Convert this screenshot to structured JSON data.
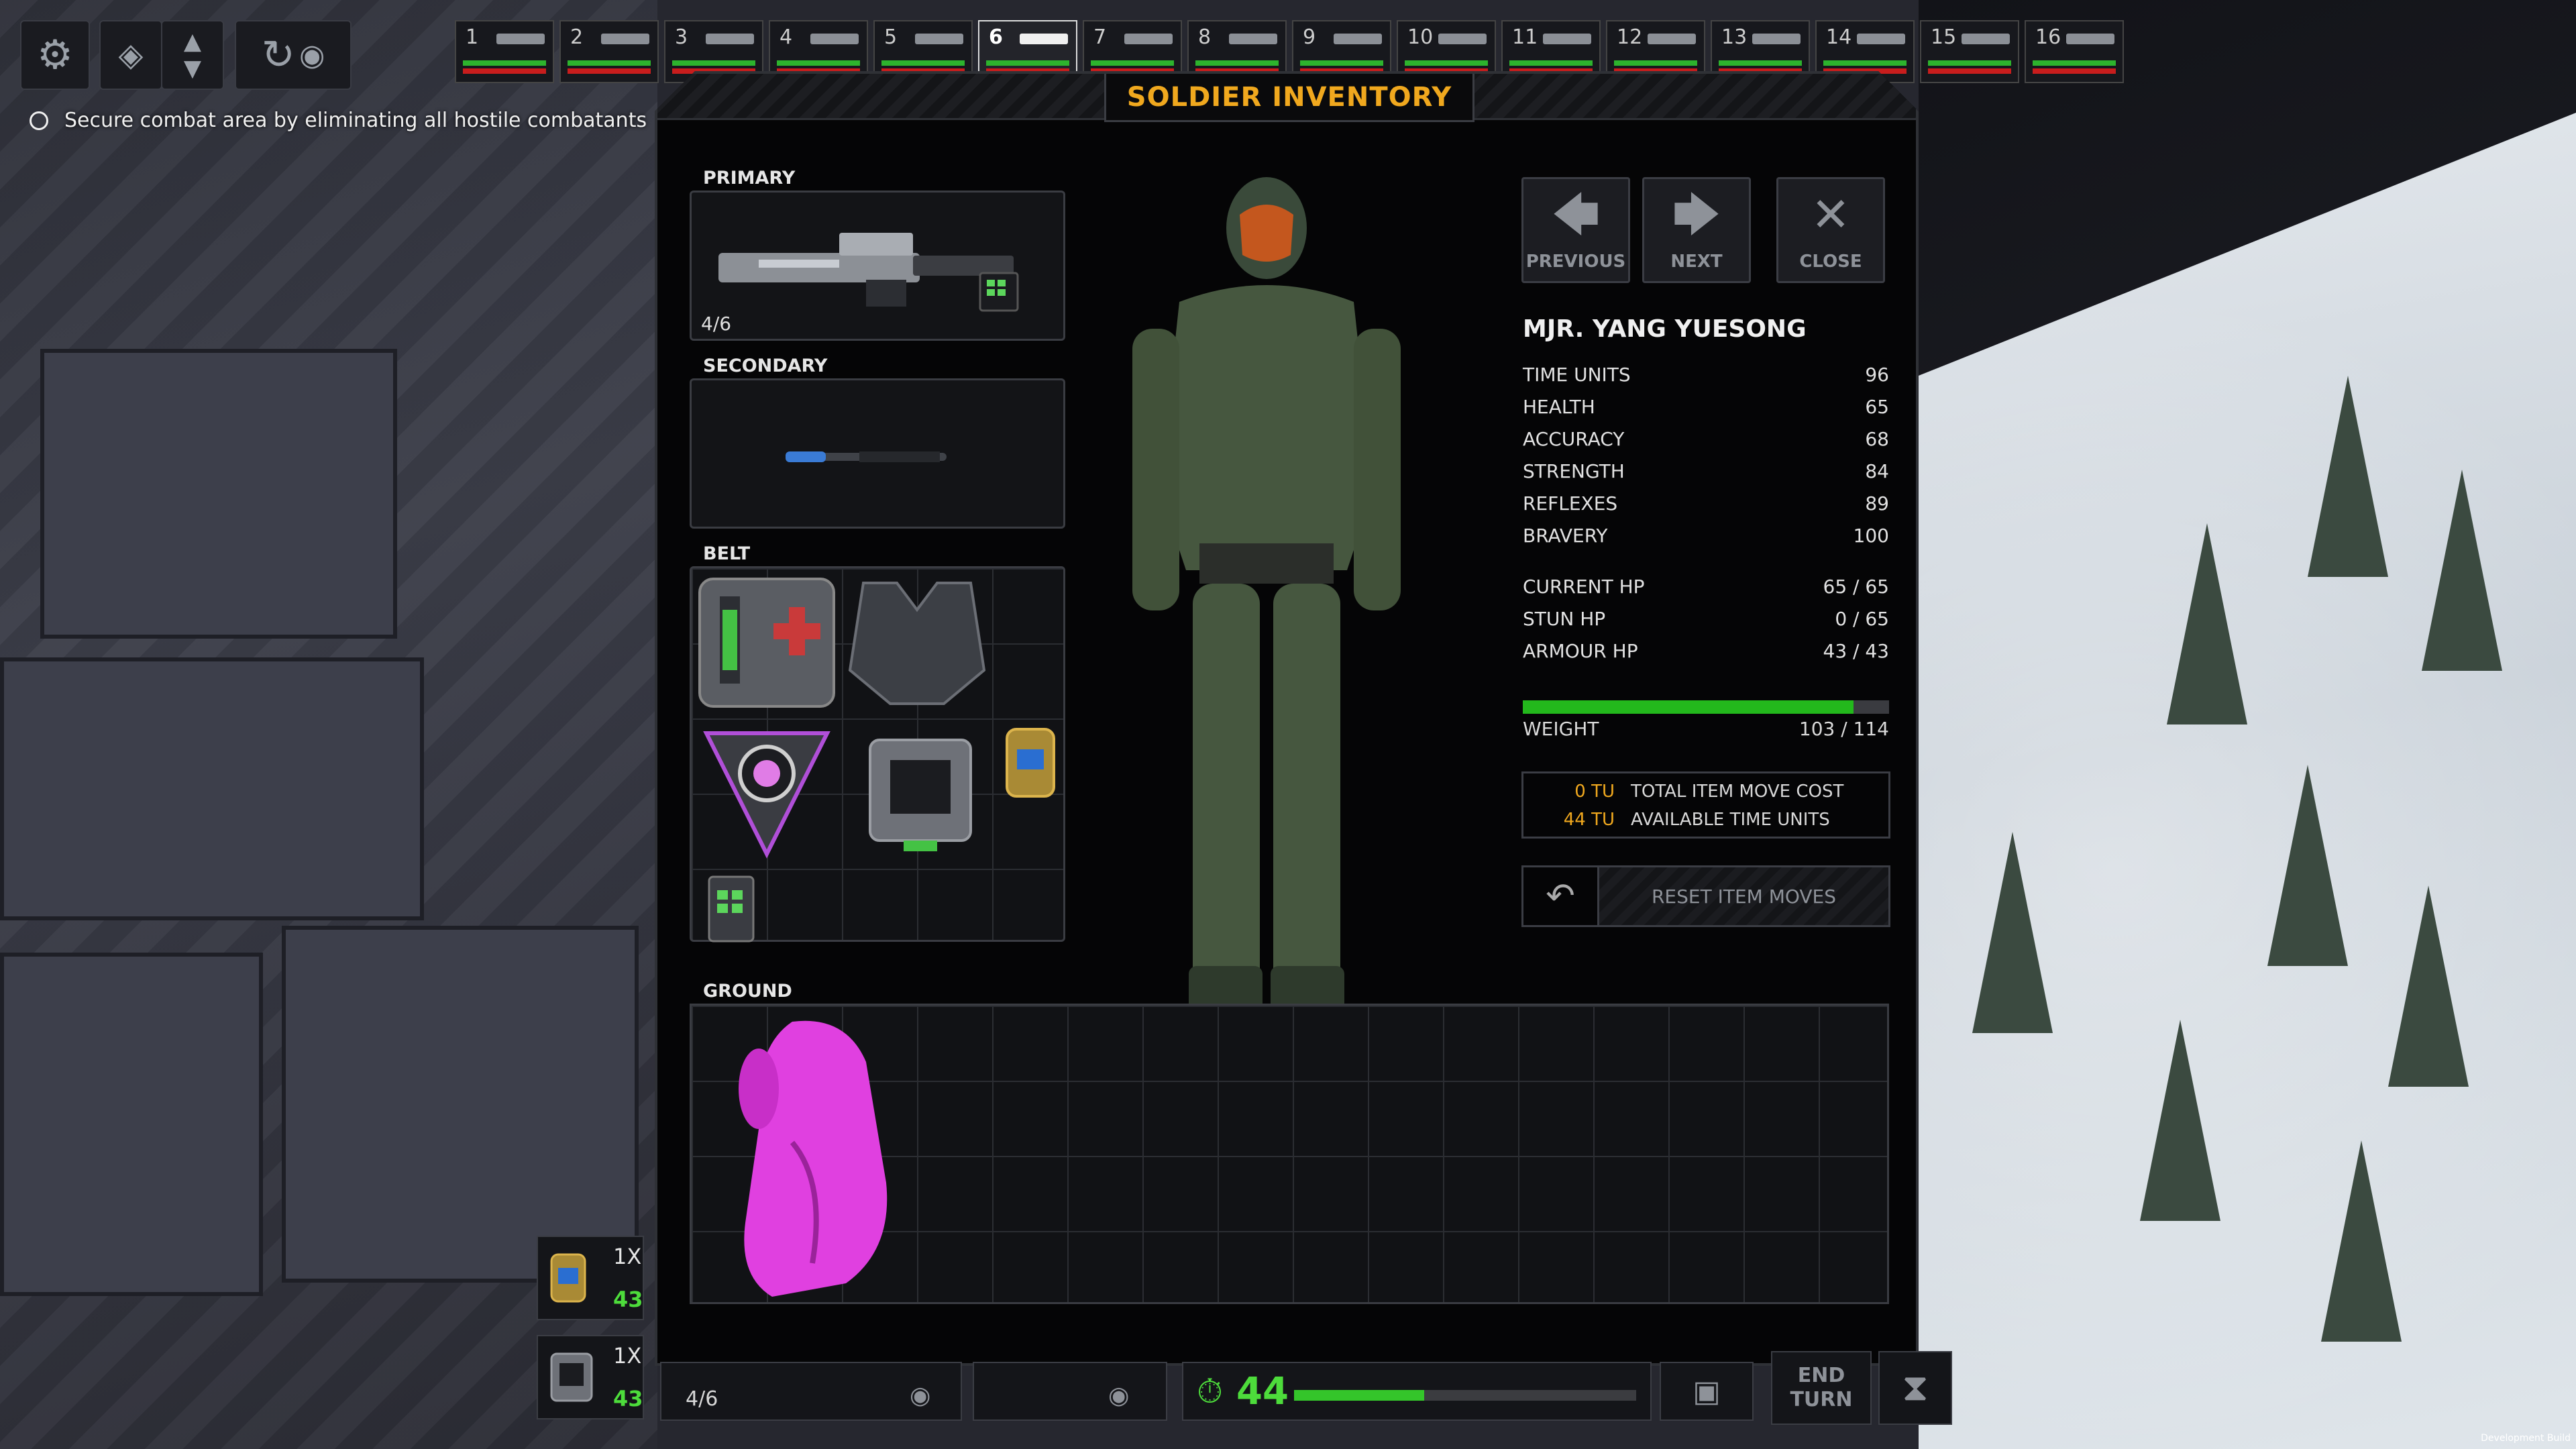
{
  "objective": {
    "text": "Secure combat area by eliminating all hostile combatants"
  },
  "squad": {
    "slots": [
      {
        "num": "1"
      },
      {
        "num": "2"
      },
      {
        "num": "3"
      },
      {
        "num": "4"
      },
      {
        "num": "5"
      },
      {
        "num": "6",
        "active": true
      },
      {
        "num": "7"
      },
      {
        "num": "8"
      },
      {
        "num": "9"
      },
      {
        "num": "10"
      },
      {
        "num": "11"
      },
      {
        "num": "12"
      },
      {
        "num": "13"
      },
      {
        "num": "14"
      },
      {
        "num": "15"
      },
      {
        "num": "16"
      }
    ]
  },
  "inventory": {
    "title": "SOLDIER INVENTORY",
    "primary_label": "PRIMARY",
    "primary_ammo": "4/6",
    "secondary_label": "SECONDARY",
    "belt_label": "BELT",
    "ground_label": "GROUND"
  },
  "nav": {
    "previous": "PREVIOUS",
    "next": "NEXT",
    "close": "CLOSE"
  },
  "soldier": {
    "name": "MJR. YANG YUESONG",
    "stats": [
      {
        "label": "TIME UNITS",
        "value": "96"
      },
      {
        "label": "HEALTH",
        "value": "65"
      },
      {
        "label": "ACCURACY",
        "value": "68"
      },
      {
        "label": "STRENGTH",
        "value": "84"
      },
      {
        "label": "REFLEXES",
        "value": "89"
      },
      {
        "label": "BRAVERY",
        "value": "100"
      }
    ],
    "hp": [
      {
        "label": "CURRENT HP",
        "value": "65 / 65"
      },
      {
        "label": "STUN HP",
        "value": "0 / 65"
      },
      {
        "label": "ARMOUR HP",
        "value": "43 / 43"
      }
    ],
    "weight_label": "WEIGHT",
    "weight_value": "103 / 114",
    "weight_fraction": 0.9035
  },
  "tu": {
    "cost_value": "0 TU",
    "cost_label": "TOTAL ITEM MOVE COST",
    "avail_value": "44 TU",
    "avail_label": "AVAILABLE TIME UNITS"
  },
  "reset": {
    "label": "RESET ITEM MOVES"
  },
  "hud": {
    "item1_qty": "1X",
    "item1_count": "43",
    "item2_qty": "1X",
    "item2_count": "43",
    "weapon_ammo": "4/6",
    "time_units": "44",
    "time_units_fraction": 0.38,
    "end_turn": "END TURN"
  },
  "footer": {
    "build": "Development Build"
  },
  "colors": {
    "accent": "#f0a81e",
    "green": "#4ddc3b",
    "red": "#c81d1d",
    "ground_item": "#e040e0"
  },
  "icons": [
    "gear-icon",
    "layers-icon",
    "arrow-up-icon",
    "arrow-down-icon",
    "rotate-icon",
    "eye-icon",
    "arrow-left-icon",
    "arrow-right-icon",
    "close-icon",
    "undo-icon",
    "stopwatch-icon",
    "hourglass-icon"
  ]
}
